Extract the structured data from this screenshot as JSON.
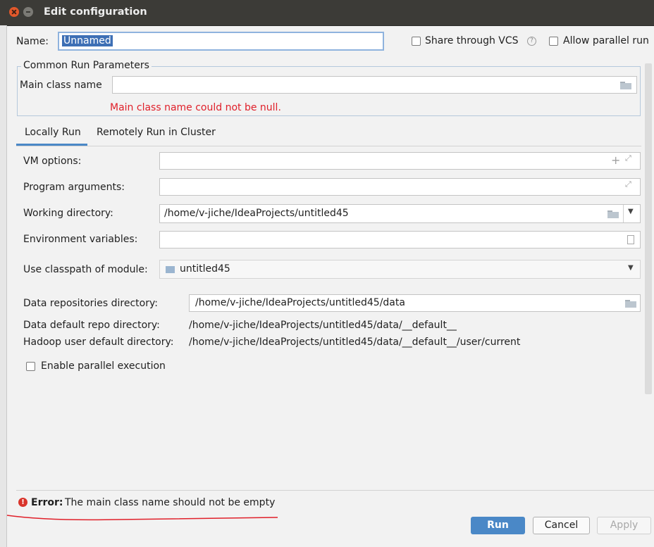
{
  "window": {
    "title": "Edit configuration"
  },
  "header": {
    "name_label": "Name:",
    "name_value": "Unnamed",
    "share_vcs_label": "Share through VCS",
    "help_glyph": "?",
    "allow_parallel_label": "Allow parallel run"
  },
  "common": {
    "group_title": "Common Run Parameters",
    "main_class_label": "Main class name",
    "main_class_value": "",
    "main_class_error": "Main class name could not be null."
  },
  "tabs": [
    {
      "label": "Locally Run",
      "selected": true
    },
    {
      "label": "Remotely Run in Cluster",
      "selected": false
    }
  ],
  "form": {
    "vm_options_label": "VM options:",
    "vm_options_value": "",
    "program_args_label": "Program arguments:",
    "program_args_value": "",
    "working_dir_label": "Working directory:",
    "working_dir_value": "/home/v-jiche/IdeaProjects/untitled45",
    "env_vars_label": "Environment variables:",
    "env_vars_value": "",
    "classpath_label": "Use classpath of module:",
    "classpath_value": "untitled45",
    "data_repo_label": "Data repositories directory:",
    "data_repo_value": "/home/v-jiche/IdeaProjects/untitled45/data",
    "data_default_label": "Data default repo directory:",
    "data_default_value": "/home/v-jiche/IdeaProjects/untitled45/data/__default__",
    "hadoop_label": "Hadoop user default directory:",
    "hadoop_value": "/home/v-jiche/IdeaProjects/untitled45/data/__default__/user/current",
    "enable_parallel_label": "Enable parallel execution"
  },
  "footer": {
    "error_prefix": "Error:",
    "error_text": "The main class name should not be empty",
    "run_label": "Run",
    "cancel_label": "Cancel",
    "apply_label": "Apply"
  },
  "icons": {
    "close": "close-icon",
    "minimize": "minimize-icon",
    "folder": "folder-icon",
    "expand": "expand-icon",
    "plus": "plus-icon",
    "dropdown": "chevron-down-icon",
    "document": "document-icon",
    "error": "error-icon",
    "module": "module-icon"
  },
  "colors": {
    "accent": "#4a88c7",
    "error_red": "#e0202a",
    "run_button": "#4a88c7",
    "title_bar": "#3c3b37"
  }
}
